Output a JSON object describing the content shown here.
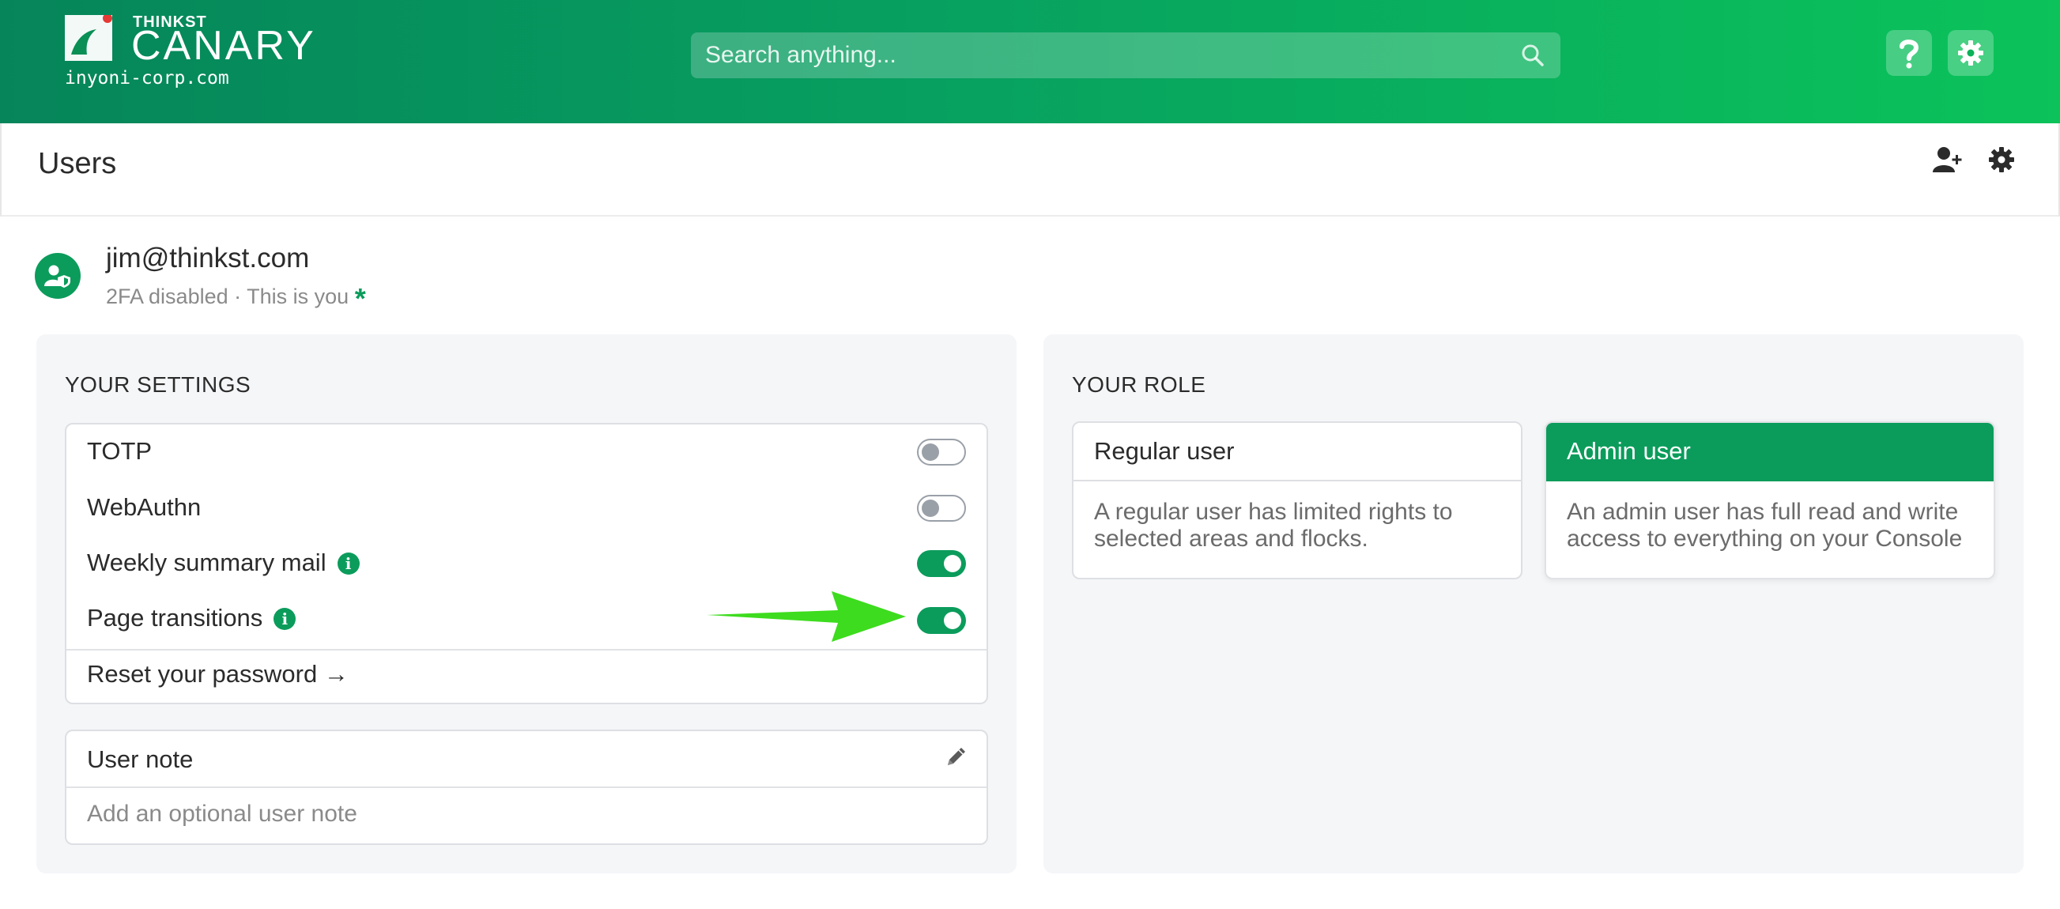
{
  "header": {
    "brand_small": "THINKST",
    "brand_name": "CANARY",
    "domain": "inyoni-corp.com",
    "search_placeholder": "Search anything...",
    "help_icon": "question-icon",
    "settings_icon": "gear-icon"
  },
  "page": {
    "title": "Users",
    "actions": [
      "add-user-icon",
      "gear-icon"
    ]
  },
  "user": {
    "email": "jim@thinkst.com",
    "status": "2FA disabled · This is you",
    "marker": "*",
    "avatar_icon": "user-shield-icon"
  },
  "settings": {
    "heading": "YOUR SETTINGS",
    "items": [
      {
        "label": "TOTP",
        "enabled": false,
        "info": false
      },
      {
        "label": "WebAuthn",
        "enabled": false,
        "info": false
      },
      {
        "label": "Weekly summary mail",
        "enabled": true,
        "info": true
      },
      {
        "label": "Page transitions",
        "enabled": true,
        "info": true
      }
    ],
    "reset_label": "Reset your password →"
  },
  "note": {
    "title": "User note",
    "placeholder": "Add an optional user note",
    "edit_icon": "pencil-icon"
  },
  "role": {
    "heading": "YOUR ROLE",
    "options": [
      {
        "name": "Regular user",
        "description": "A regular user has limited rights to selected areas and flocks.",
        "selected": false
      },
      {
        "name": "Admin user",
        "description": "An admin user has full read and write access to everything on your Console",
        "selected": true
      }
    ]
  },
  "colors": {
    "brand_green": "#0b9c5b",
    "header_gradient_start": "#06855a",
    "header_gradient_end": "#0bc35a",
    "annotation_arrow": "#3ddc1e"
  }
}
